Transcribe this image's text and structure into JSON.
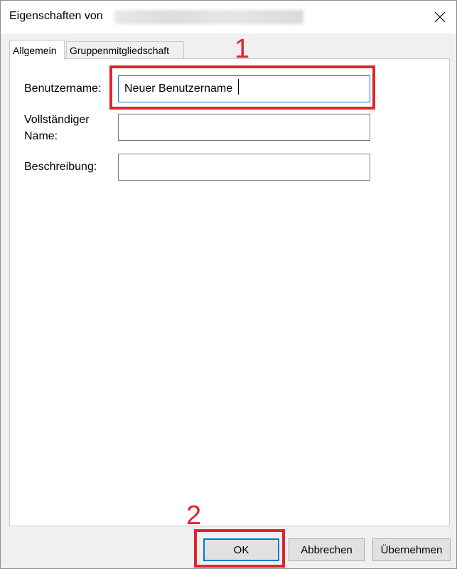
{
  "window": {
    "title": "Eigenschaften von",
    "close_icon": "close-icon"
  },
  "tabs": [
    {
      "label": "Allgemein",
      "active": true
    },
    {
      "label": "Gruppenmitgliedschaft",
      "active": false
    }
  ],
  "form": {
    "username_label": "Benutzername:",
    "username_value": "Neuer Benutzername",
    "fullname_label": "Vollständiger Name:",
    "fullname_value": "",
    "description_label": "Beschreibung:",
    "description_value": ""
  },
  "buttons": {
    "ok": "OK",
    "cancel": "Abbrechen",
    "apply": "Übernehmen"
  },
  "annotations": {
    "step1": "1",
    "step2": "2",
    "color": "#e3232c"
  },
  "colors": {
    "focus_accent": "#0078d7"
  }
}
